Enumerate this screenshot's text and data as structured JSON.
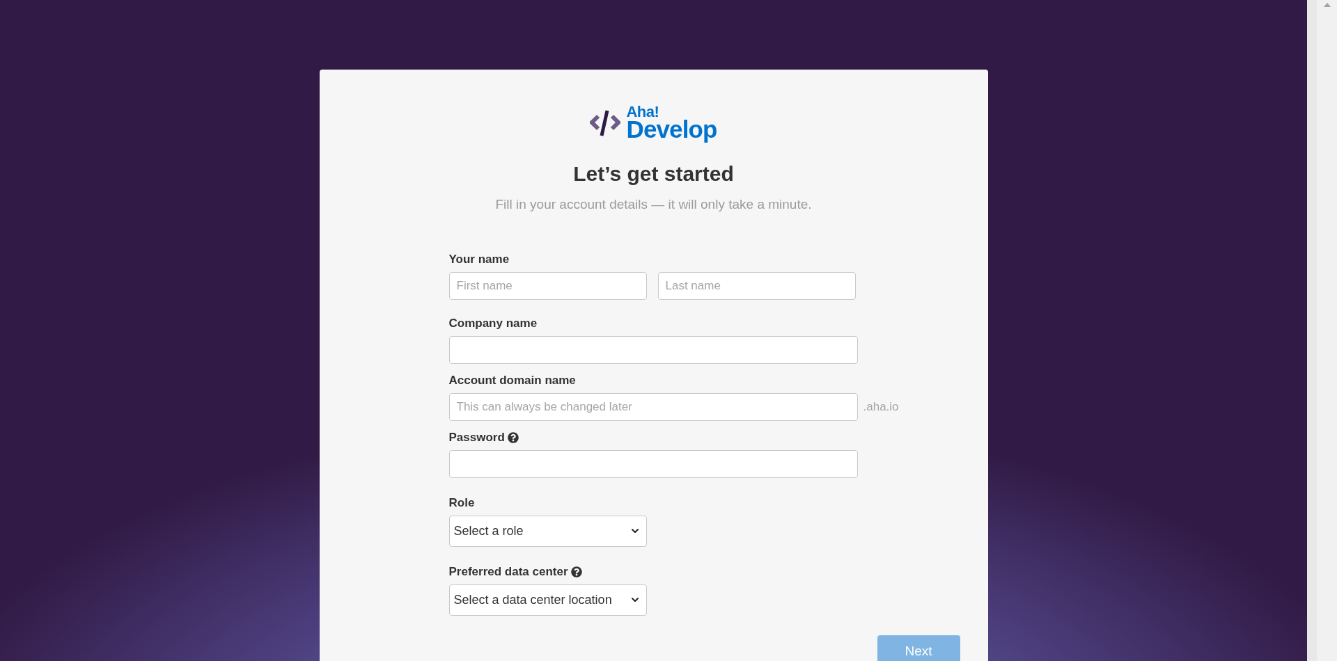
{
  "logo": {
    "brand": "Aha!",
    "product": "Develop"
  },
  "heading": "Let’s get started",
  "subtitle": "Fill in your account details — it will only take a minute.",
  "fields": [
    {
      "kind": "name_pair",
      "label": "Your name",
      "inputs": [
        {
          "placeholder": "First name"
        },
        {
          "placeholder": "Last name"
        }
      ]
    },
    {
      "kind": "text",
      "label": "Company name"
    },
    {
      "kind": "text",
      "label": "Account domain name",
      "placeholder": "This can always be changed later",
      "suffix": ".aha.io"
    },
    {
      "kind": "password",
      "label": "Password",
      "help": true
    },
    {
      "kind": "select",
      "label": "Role",
      "value": "Select a role"
    },
    {
      "kind": "select",
      "label": "Preferred data center",
      "help": true,
      "value": "Select a data center location"
    }
  ],
  "next_button": {
    "label": "Next",
    "disabled": true
  }
}
